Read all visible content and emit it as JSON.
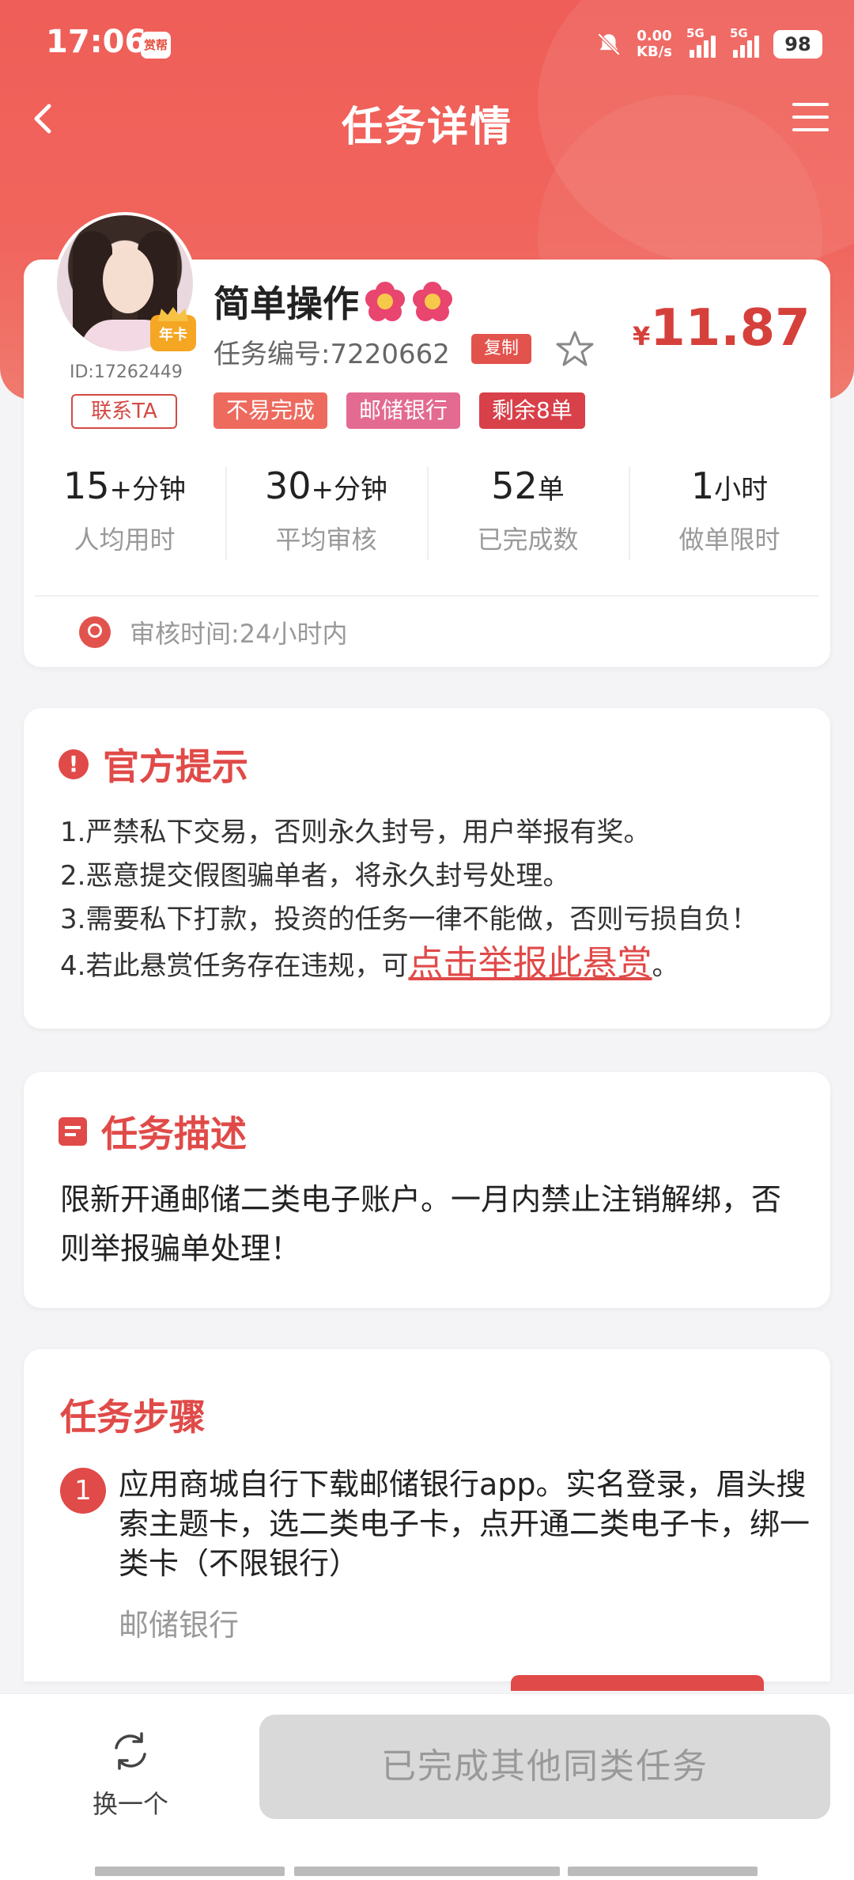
{
  "status_bar": {
    "time": "17:06",
    "app_icon_text": "赏帮",
    "speed_value": "0.00",
    "speed_unit": "KB/s",
    "signal1": "5G",
    "signal2": "5G",
    "battery": "98"
  },
  "nav": {
    "title": "任务详情",
    "back_icon": "chevron-left-icon",
    "menu_icon": "hamburger-menu-icon"
  },
  "task": {
    "title": "简单操作",
    "emoji_icon": "hibiscus-flower-icon",
    "code_label": "任务编号:7220662",
    "copy_label": "复制",
    "price_symbol": "¥",
    "price": "11.87",
    "user_id": "ID:17262449",
    "vip_label": "年卡",
    "contact_label": "联系TA",
    "tags": [
      {
        "label": "不易完成",
        "color": "#ee6a5e"
      },
      {
        "label": "邮储银行",
        "color": "#e36a91"
      },
      {
        "label": "剩余8单",
        "color": "#d8404a"
      }
    ],
    "stats": [
      {
        "value": "15",
        "unit": "+分钟",
        "label": "人均用时"
      },
      {
        "value": "30",
        "unit": "+分钟",
        "label": "平均审核"
      },
      {
        "value": "52",
        "unit": "单",
        "label": "已完成数"
      },
      {
        "value": "1",
        "unit": "小时",
        "label": "做单限时"
      }
    ],
    "review_time": "审核时间:24小时内"
  },
  "notice": {
    "title": "官方提示",
    "lines": [
      "1.严禁私下交易，否则永久封号，用户举报有奖。",
      "2.恶意提交假图骗单者，将永久封号处理。",
      "3.需要私下打款，投资的任务一律不能做，否则亏损自负！"
    ],
    "line4_prefix": "4.若此悬赏任务存在违规，可",
    "line4_link": "点击举报此悬赏",
    "line4_suffix": "。"
  },
  "description": {
    "title": "任务描述",
    "text": "限新开通邮储二类电子账户。一月内禁止注销解绑，否则举报骗单处理！"
  },
  "steps": {
    "title": "任务步骤",
    "items": [
      {
        "num": "1",
        "text": "应用商城自行下载邮储银行app。实名登录，眉头搜索主题卡，选二类电子卡，点开通二类电子卡，绑一类卡（不限银行）",
        "sub": "邮储银行"
      }
    ]
  },
  "bottom": {
    "swap_label": "换一个",
    "main_button": "已完成其他同类任务"
  },
  "colors": {
    "accent": "#e04a48",
    "header": "#ef5e58",
    "price": "#d6403b",
    "disabled_button": "#d9d9d9"
  }
}
